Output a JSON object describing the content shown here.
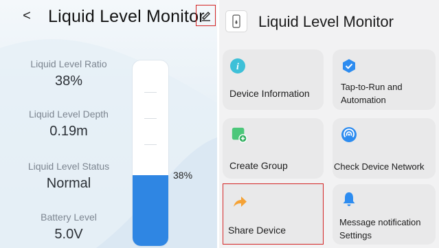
{
  "left": {
    "back_glyph": "<",
    "title": "Liquid Level Monitor",
    "metrics": [
      {
        "label": "Liquid Level Ratio",
        "value": "38%"
      },
      {
        "label": "Liquid Level Depth",
        "value": "0.19m"
      },
      {
        "label": "Liquid Level Status",
        "value": "Normal"
      },
      {
        "label": "Battery Level",
        "value": "5.0V"
      }
    ],
    "tank": {
      "level_percent": 38,
      "level_label": "38%",
      "fill_color": "#2f86e3"
    }
  },
  "right": {
    "title": "Liquid Level Monitor",
    "cards": [
      {
        "label": "Device Information",
        "icon": "info-icon",
        "icon_color": "#3ec0d8"
      },
      {
        "label": "Tap-to-Run and Automation",
        "icon": "checkmark-shield-icon",
        "icon_color": "#2d8cf0"
      },
      {
        "label": "Create Group",
        "icon": "add-group-icon",
        "icon_color": "#4cc77a"
      },
      {
        "label": "Check Device Network",
        "icon": "network-signal-icon",
        "icon_color": "#2d8cf0"
      },
      {
        "label": "Share Device",
        "icon": "share-arrow-icon",
        "icon_color": "#f5a235"
      },
      {
        "label": "Message notification Settings",
        "icon": "bell-icon",
        "icon_color": "#2d8cf0"
      }
    ]
  },
  "colors": {
    "highlight_outline": "#d32424",
    "accent_blue": "#2f86e3"
  }
}
